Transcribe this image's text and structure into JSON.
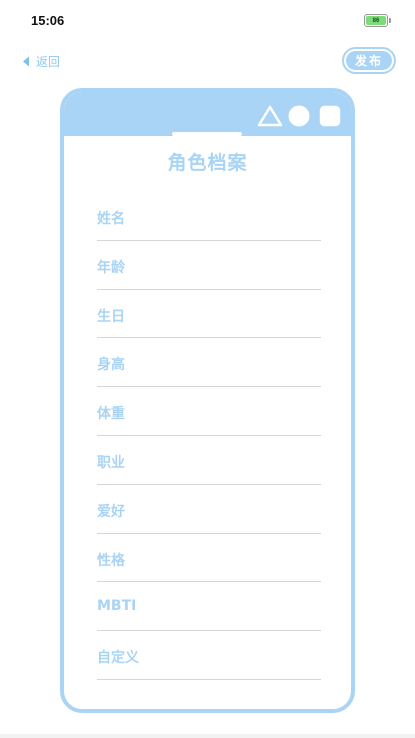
{
  "status_bar": {
    "time": "15:06",
    "battery_level": "86",
    "battery_color": "#7ddc7a"
  },
  "nav": {
    "back_label": "返回",
    "back_icon": "chevron-left-icon",
    "publish_label": "发布"
  },
  "card": {
    "title": "角色档案",
    "header_icons": [
      "triangle-icon",
      "circle-icon",
      "square-icon"
    ],
    "fields": [
      {
        "label": "姓名"
      },
      {
        "label": "年龄"
      },
      {
        "label": "生日"
      },
      {
        "label": "身高"
      },
      {
        "label": "体重"
      },
      {
        "label": "职业"
      },
      {
        "label": "爱好"
      },
      {
        "label": "性格"
      },
      {
        "label": "MBTI"
      },
      {
        "label": "自定义"
      }
    ]
  },
  "colors": {
    "accent": "#a9d4f5",
    "divider": "#d6d6d6"
  }
}
